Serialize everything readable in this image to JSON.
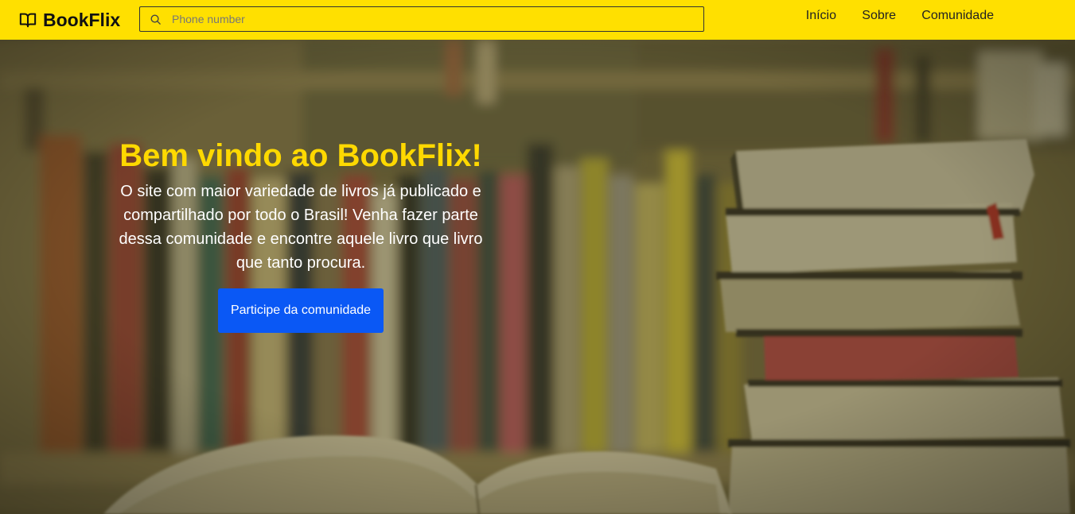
{
  "brand": {
    "name": "BookFlix",
    "icon": "open-book-icon"
  },
  "search": {
    "placeholder": "Phone number",
    "value": "",
    "icon": "search-icon"
  },
  "nav": {
    "items": [
      {
        "label": "Início"
      },
      {
        "label": "Sobre"
      },
      {
        "label": "Comunidade"
      }
    ]
  },
  "hero": {
    "title": "Bem vindo ao BookFlix!",
    "text": "O site com maior variedade de livros já publicado e compartilhado por todo o Brasil! Venha fazer parte dessa comunidade e encontre aquele livro que livro que tanto procura.",
    "button_label": "Participe da comunidade",
    "background": "blurred-bookshelf-with-stacked-books-image"
  },
  "colors": {
    "navbar": "#FFE000",
    "title": "#FFD900",
    "button": "#0A58F5",
    "overlay": "#6d6541"
  }
}
